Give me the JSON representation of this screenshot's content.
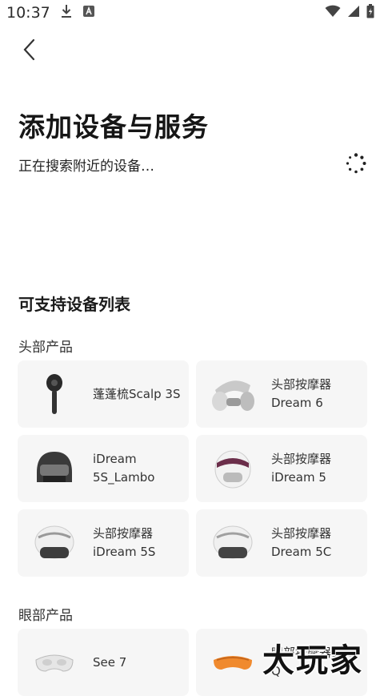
{
  "status_bar": {
    "time": "10:37"
  },
  "header": {
    "title": "添加设备与服务",
    "searching_text": "正在搜索附近的设备…"
  },
  "supported": {
    "title": "可支持设备列表",
    "categories": [
      {
        "name": "头部产品",
        "items": [
          {
            "line1": "蓬蓬梳Scalp 3S",
            "line2": ""
          },
          {
            "line1": "头部按摩器",
            "line2": "Dream 6"
          },
          {
            "line1": "iDream",
            "line2": "5S_Lambo"
          },
          {
            "line1": "头部按摩器",
            "line2": "iDream 5"
          },
          {
            "line1": "头部按摩器",
            "line2": "iDream 5S"
          },
          {
            "line1": "头部按摩器",
            "line2": "Dream 5C"
          }
        ]
      },
      {
        "name": "眼部产品",
        "items": [
          {
            "line1": "See 7",
            "line2": ""
          },
          {
            "line1": "眼部按摩器See",
            "line2": "Q"
          }
        ]
      }
    ]
  },
  "watermark": "大玩家",
  "colors": {
    "card_bg": "#f6f6f6",
    "eye_mask_orange": "#f08a2e"
  }
}
